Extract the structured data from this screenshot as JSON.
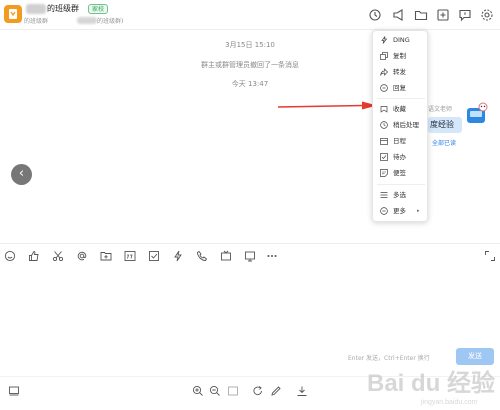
{
  "header": {
    "title_suffix": "的班级群",
    "tag": "家校",
    "sub_prefix": "的班级群",
    "sub_suffix": "的班级群)"
  },
  "chat": {
    "timestamp1": "3月15日 15:10",
    "system_msg": "群主或群管理员撤回了一条消息",
    "timestamp2": "今天 13:47",
    "message_sender_suffix": "语文老师",
    "message_text": "度经验",
    "read_status": "全部已读"
  },
  "context_menu": {
    "items": [
      {
        "label": "DING",
        "icon": "ding-icon"
      },
      {
        "label": "复制",
        "icon": "copy-icon"
      },
      {
        "label": "转发",
        "icon": "forward-icon"
      },
      {
        "label": "回复",
        "icon": "reply-icon"
      },
      {
        "label": "收藏",
        "icon": "favorite-icon"
      },
      {
        "label": "稍后处理",
        "icon": "later-icon"
      },
      {
        "label": "日程",
        "icon": "calendar-icon"
      },
      {
        "label": "待办",
        "icon": "todo-icon"
      },
      {
        "label": "便签",
        "icon": "note-icon"
      },
      {
        "label": "多选",
        "icon": "multiselect-icon"
      },
      {
        "label": "更多",
        "icon": "more-icon",
        "arrow": "▸"
      }
    ]
  },
  "input": {
    "send_hint": "Enter 发送，Ctrl+Enter 换行",
    "send_label": "发送"
  },
  "watermark": {
    "text": "Bai du 经验",
    "url": "jingyan.baidu.com"
  },
  "colors": {
    "accent": "#2f7ce8",
    "arrow": "#e53a2f",
    "send_disabled": "#9fc7f4"
  }
}
